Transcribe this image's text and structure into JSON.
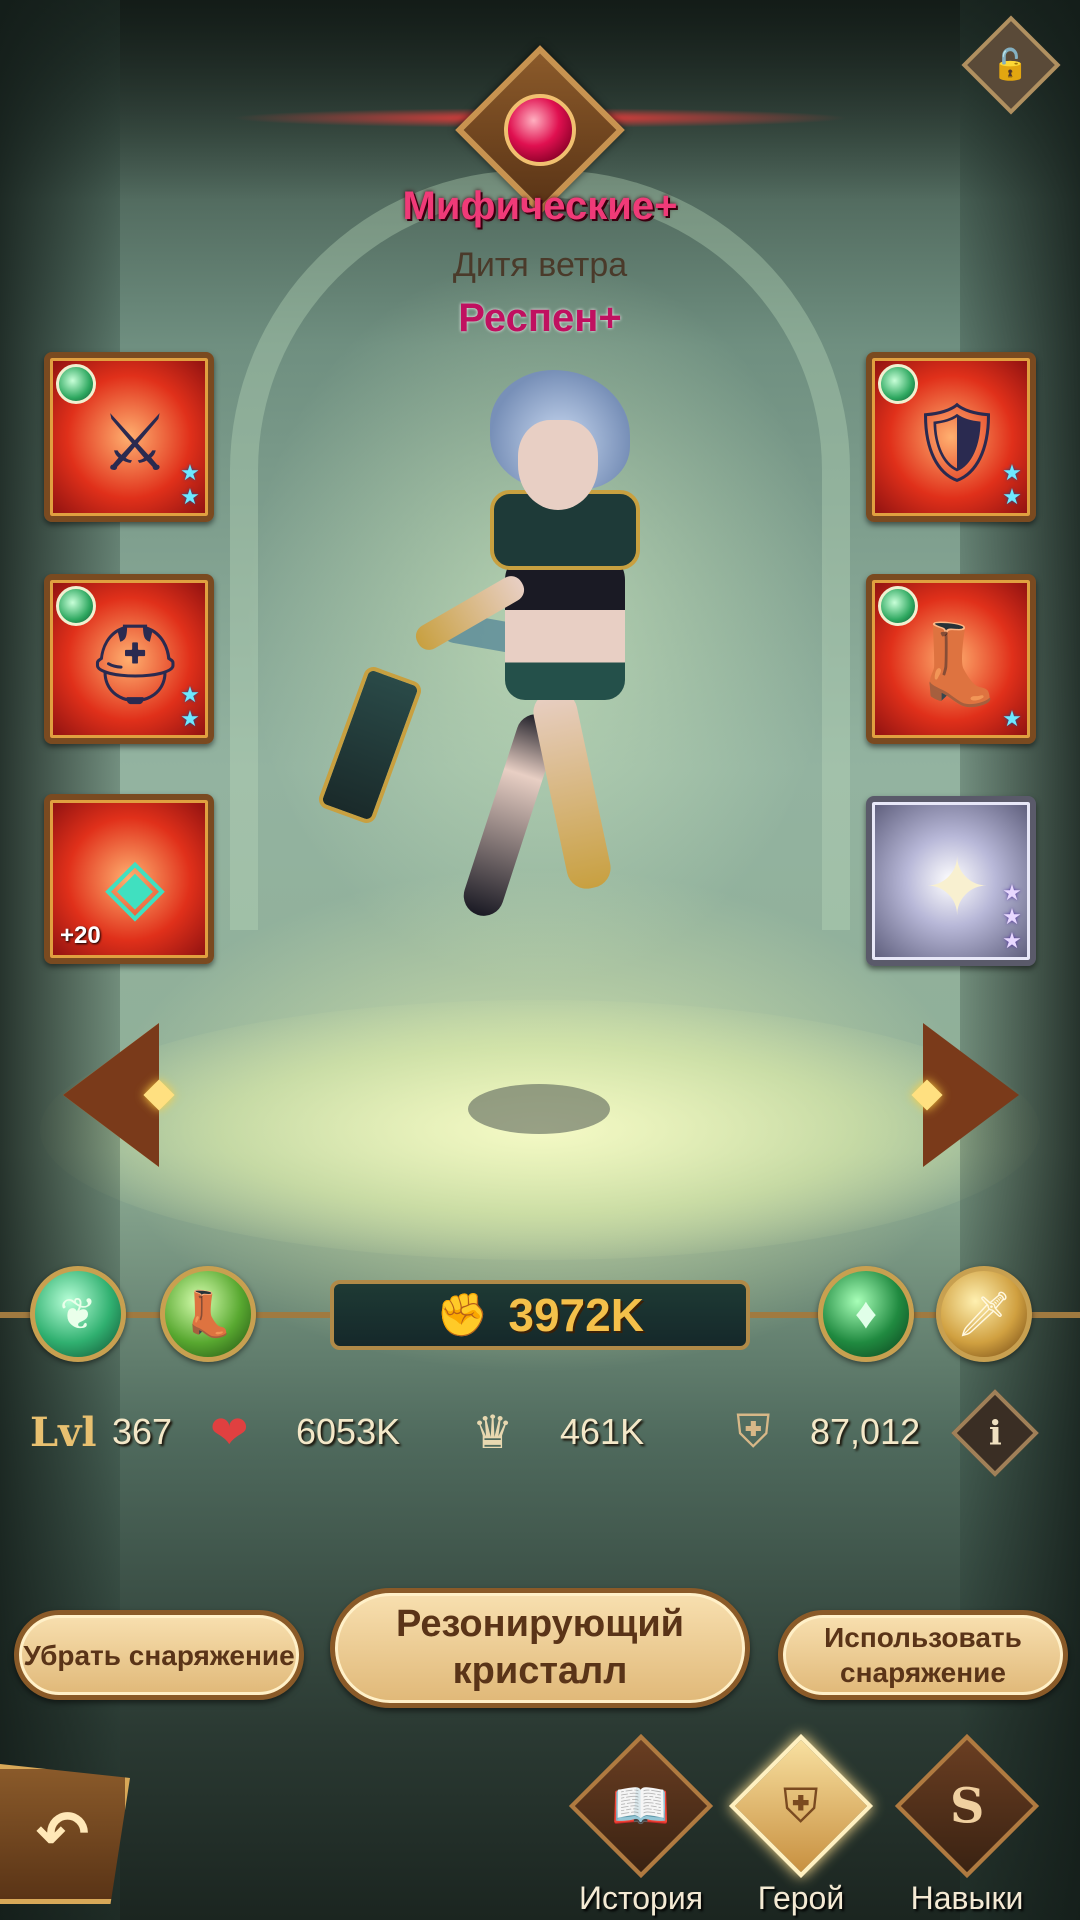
{
  "header": {
    "rarity": "Мифические+",
    "epithet": "Дитя ветра",
    "hero_name": "Респен+",
    "lock_icon": "unlock-icon"
  },
  "equipment": {
    "left": [
      {
        "slot": "weapon",
        "icon": "spear-icon",
        "stars": 2,
        "frame": "red"
      },
      {
        "slot": "helmet",
        "icon": "helmet-icon",
        "stars": 2,
        "frame": "red"
      },
      {
        "slot": "signature",
        "icon": "wind-sigil-icon",
        "plus": "+20",
        "frame": "red"
      }
    ],
    "right": [
      {
        "slot": "armor",
        "icon": "chest-armor-icon",
        "stars": 2,
        "frame": "red"
      },
      {
        "slot": "boots",
        "icon": "boots-icon",
        "stars": 1,
        "frame": "red"
      },
      {
        "slot": "furniture",
        "icon": "star-crest-icon",
        "stars": 3,
        "frame": "silver"
      }
    ]
  },
  "power": {
    "value": "3972K",
    "icon": "fist-icon"
  },
  "orbs": {
    "left": [
      "faction-wilder-icon",
      "boot-icon"
    ],
    "right": [
      "dagger-class-icon",
      "sword-icon"
    ]
  },
  "stats": {
    "level_label": "Lvl",
    "level": "367",
    "hp": "6053K",
    "attack": "461K",
    "defense": "87,012"
  },
  "actions": {
    "remove_gear": "Убрать снаряжение",
    "resonating_crystal": "Резонирующий кристалл",
    "use_gear": "Использовать снаряжение"
  },
  "nav": {
    "story": "История",
    "hero": "Герой",
    "skills": "Навыки",
    "active": "hero"
  },
  "colors": {
    "rarity": "#f03a78",
    "power": "#f4c04a",
    "frame_gold": "#b08a48",
    "star": "#6ee8ff"
  }
}
